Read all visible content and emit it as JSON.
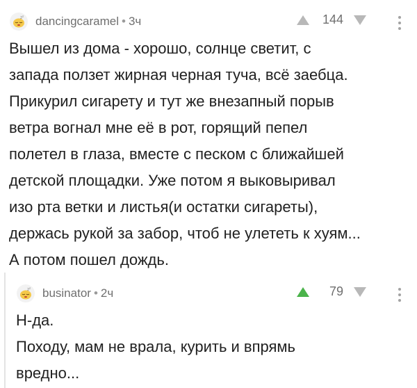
{
  "comments": [
    {
      "username": "dancingcaramel",
      "separator": "•",
      "time": "3ч",
      "votes": "144",
      "upvote_state": "neutral",
      "avatar_icon": "sleeping-face-avatar-icon",
      "lines": [
        "Вышел из дома - хорошо, солнце светит, с",
        "запада ползет жирная черная туча, всё заебца.",
        "Прикурил сигарету и тут же внезапный порыв",
        "ветра вогнал мне её в рот, горящий пепел",
        "полетел в глаза, вместе с песком с ближайшей",
        "детской площадки. Уже потом я выковыривал",
        "изо рта ветки и листья(и остатки сигареты),",
        "держась рукой за забор, чтоб не улететь к хуям...",
        "А потом пошел дождь."
      ]
    },
    {
      "username": "businator",
      "separator": "•",
      "time": "2ч",
      "votes": "79",
      "upvote_state": "active",
      "avatar_icon": "sleeping-face-avatar-icon",
      "lines": [
        "Н-да.",
        "Походу, мам не врала, курить и впрямь",
        "вредно..."
      ]
    }
  ],
  "colors": {
    "neutral_arrow": "#b8b8b8",
    "active_up_arrow": "#4bb34b",
    "meta_text": "#6f6f6f",
    "thread_line": "#e3e3e3"
  }
}
